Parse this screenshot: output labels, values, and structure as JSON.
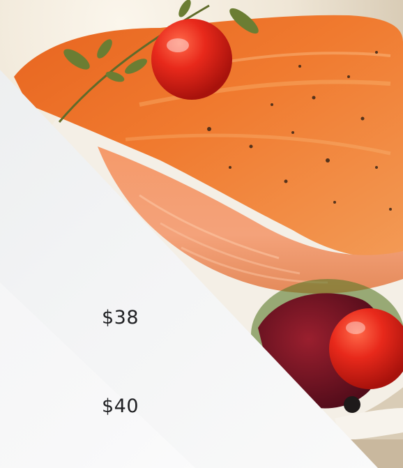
{
  "image": {
    "subject": "food-photo"
  },
  "menu": {
    "prices": [
      {
        "value": "$38"
      },
      {
        "value": "$40"
      }
    ]
  },
  "colors": {
    "panel": "#f3f4f5",
    "text": "#202124",
    "salmon": "#f08a4b",
    "tomato": "#e8291b"
  }
}
